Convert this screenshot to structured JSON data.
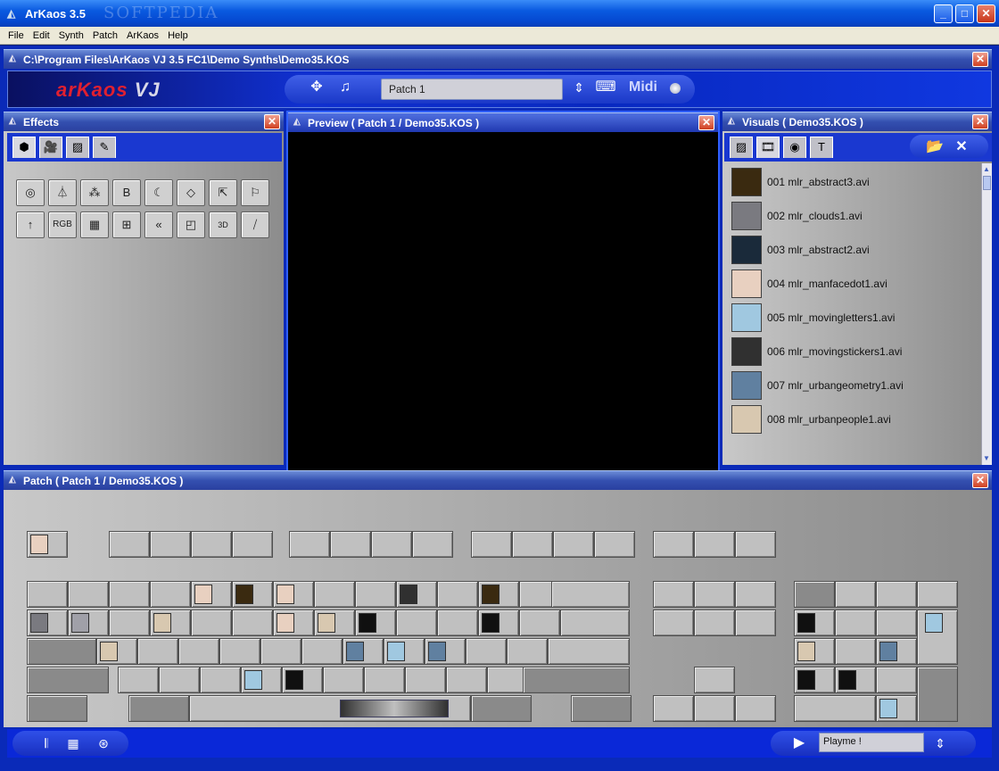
{
  "window": {
    "title": "ArKaos 3.5",
    "watermark": "SOFTPEDIA"
  },
  "menu": [
    "File",
    "Edit",
    "Synth",
    "Patch",
    "ArKaos",
    "Help"
  ],
  "path_title": "C:\\Program Files\\ArKaos VJ 3.5 FC1\\Demo Synths\\Demo35.KOS",
  "header": {
    "logo_main": "arKaos",
    "logo_vj": "VJ",
    "patch_name": "Patch 1",
    "midi_label": "Midi"
  },
  "effects": {
    "title": "Effects"
  },
  "preview": {
    "title": "Preview ( Patch 1 / Demo35.KOS )"
  },
  "visuals": {
    "title": "Visuals ( Demo35.KOS )",
    "items": [
      {
        "label": "001 mlr_abstract3.avi",
        "color": "#3a2a10"
      },
      {
        "label": "002 mlr_clouds1.avi",
        "color": "#7a7a80"
      },
      {
        "label": "003 mlr_abstract2.avi",
        "color": "#1a2a3a"
      },
      {
        "label": "004 mlr_manfacedot1.avi",
        "color": "#e8d0c0"
      },
      {
        "label": "005 mlr_movingletters1.avi",
        "color": "#a0c8e0"
      },
      {
        "label": "006 mlr_movingstickers1.avi",
        "color": "#303030"
      },
      {
        "label": "007 mlr_urbangeometry1.avi",
        "color": "#6080a0"
      },
      {
        "label": "008 mlr_urbanpeople1.avi",
        "color": "#d8c8b0"
      }
    ]
  },
  "patch": {
    "title": "Patch ( Patch 1 / Demo35.KOS )"
  },
  "bottom": {
    "playme": "Playme !"
  }
}
